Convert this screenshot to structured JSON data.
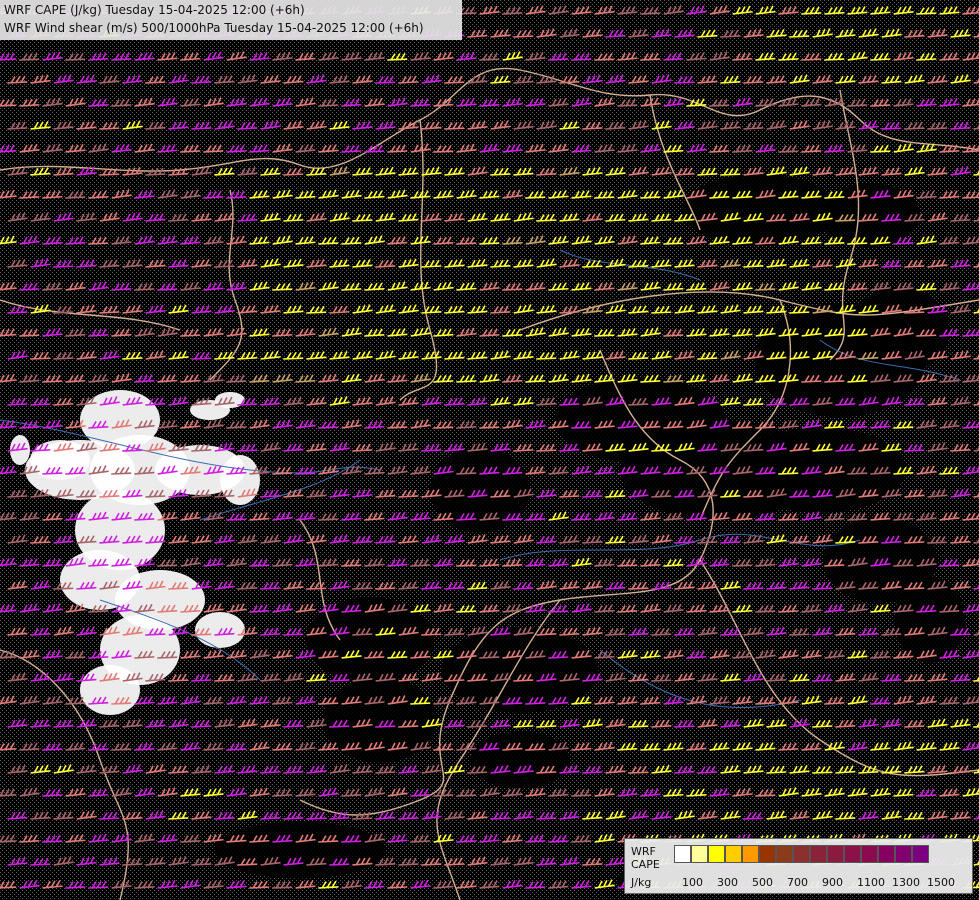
{
  "title": {
    "line1": "WRF CAPE (J/kg) Tuesday 15-04-2025 12:00 (+6h)",
    "line2": "WRF Wind shear (m/s) 500/1000hPa Tuesday 15-04-2025 12:00 (+6h)"
  },
  "legend": {
    "label_line1": "WRF",
    "label_line2": "CAPE",
    "label_line3": "J/kg",
    "colors": [
      "#ffffff",
      "#ffff99",
      "#ffff00",
      "#ffcc00",
      "#ff9900",
      "#993300",
      "#8b3a1a",
      "#8b2f2f",
      "#8b2338",
      "#8b1a40",
      "#8b1248",
      "#8b0b50",
      "#850060",
      "#800070",
      "#7a0080"
    ],
    "tick_labels": [
      "100",
      "300",
      "500",
      "700",
      "900",
      "1100",
      "1300",
      "1500"
    ]
  },
  "map": {
    "barb_colors": {
      "low": "#a8656b",
      "mid": "#e07b79",
      "high": "#d020e0",
      "veryhigh": "#ffff33",
      "tan": "#c9a064"
    },
    "border_color": "#d4b090",
    "river_color": "#3a6db0",
    "cape_white_color": "#ffffff"
  }
}
